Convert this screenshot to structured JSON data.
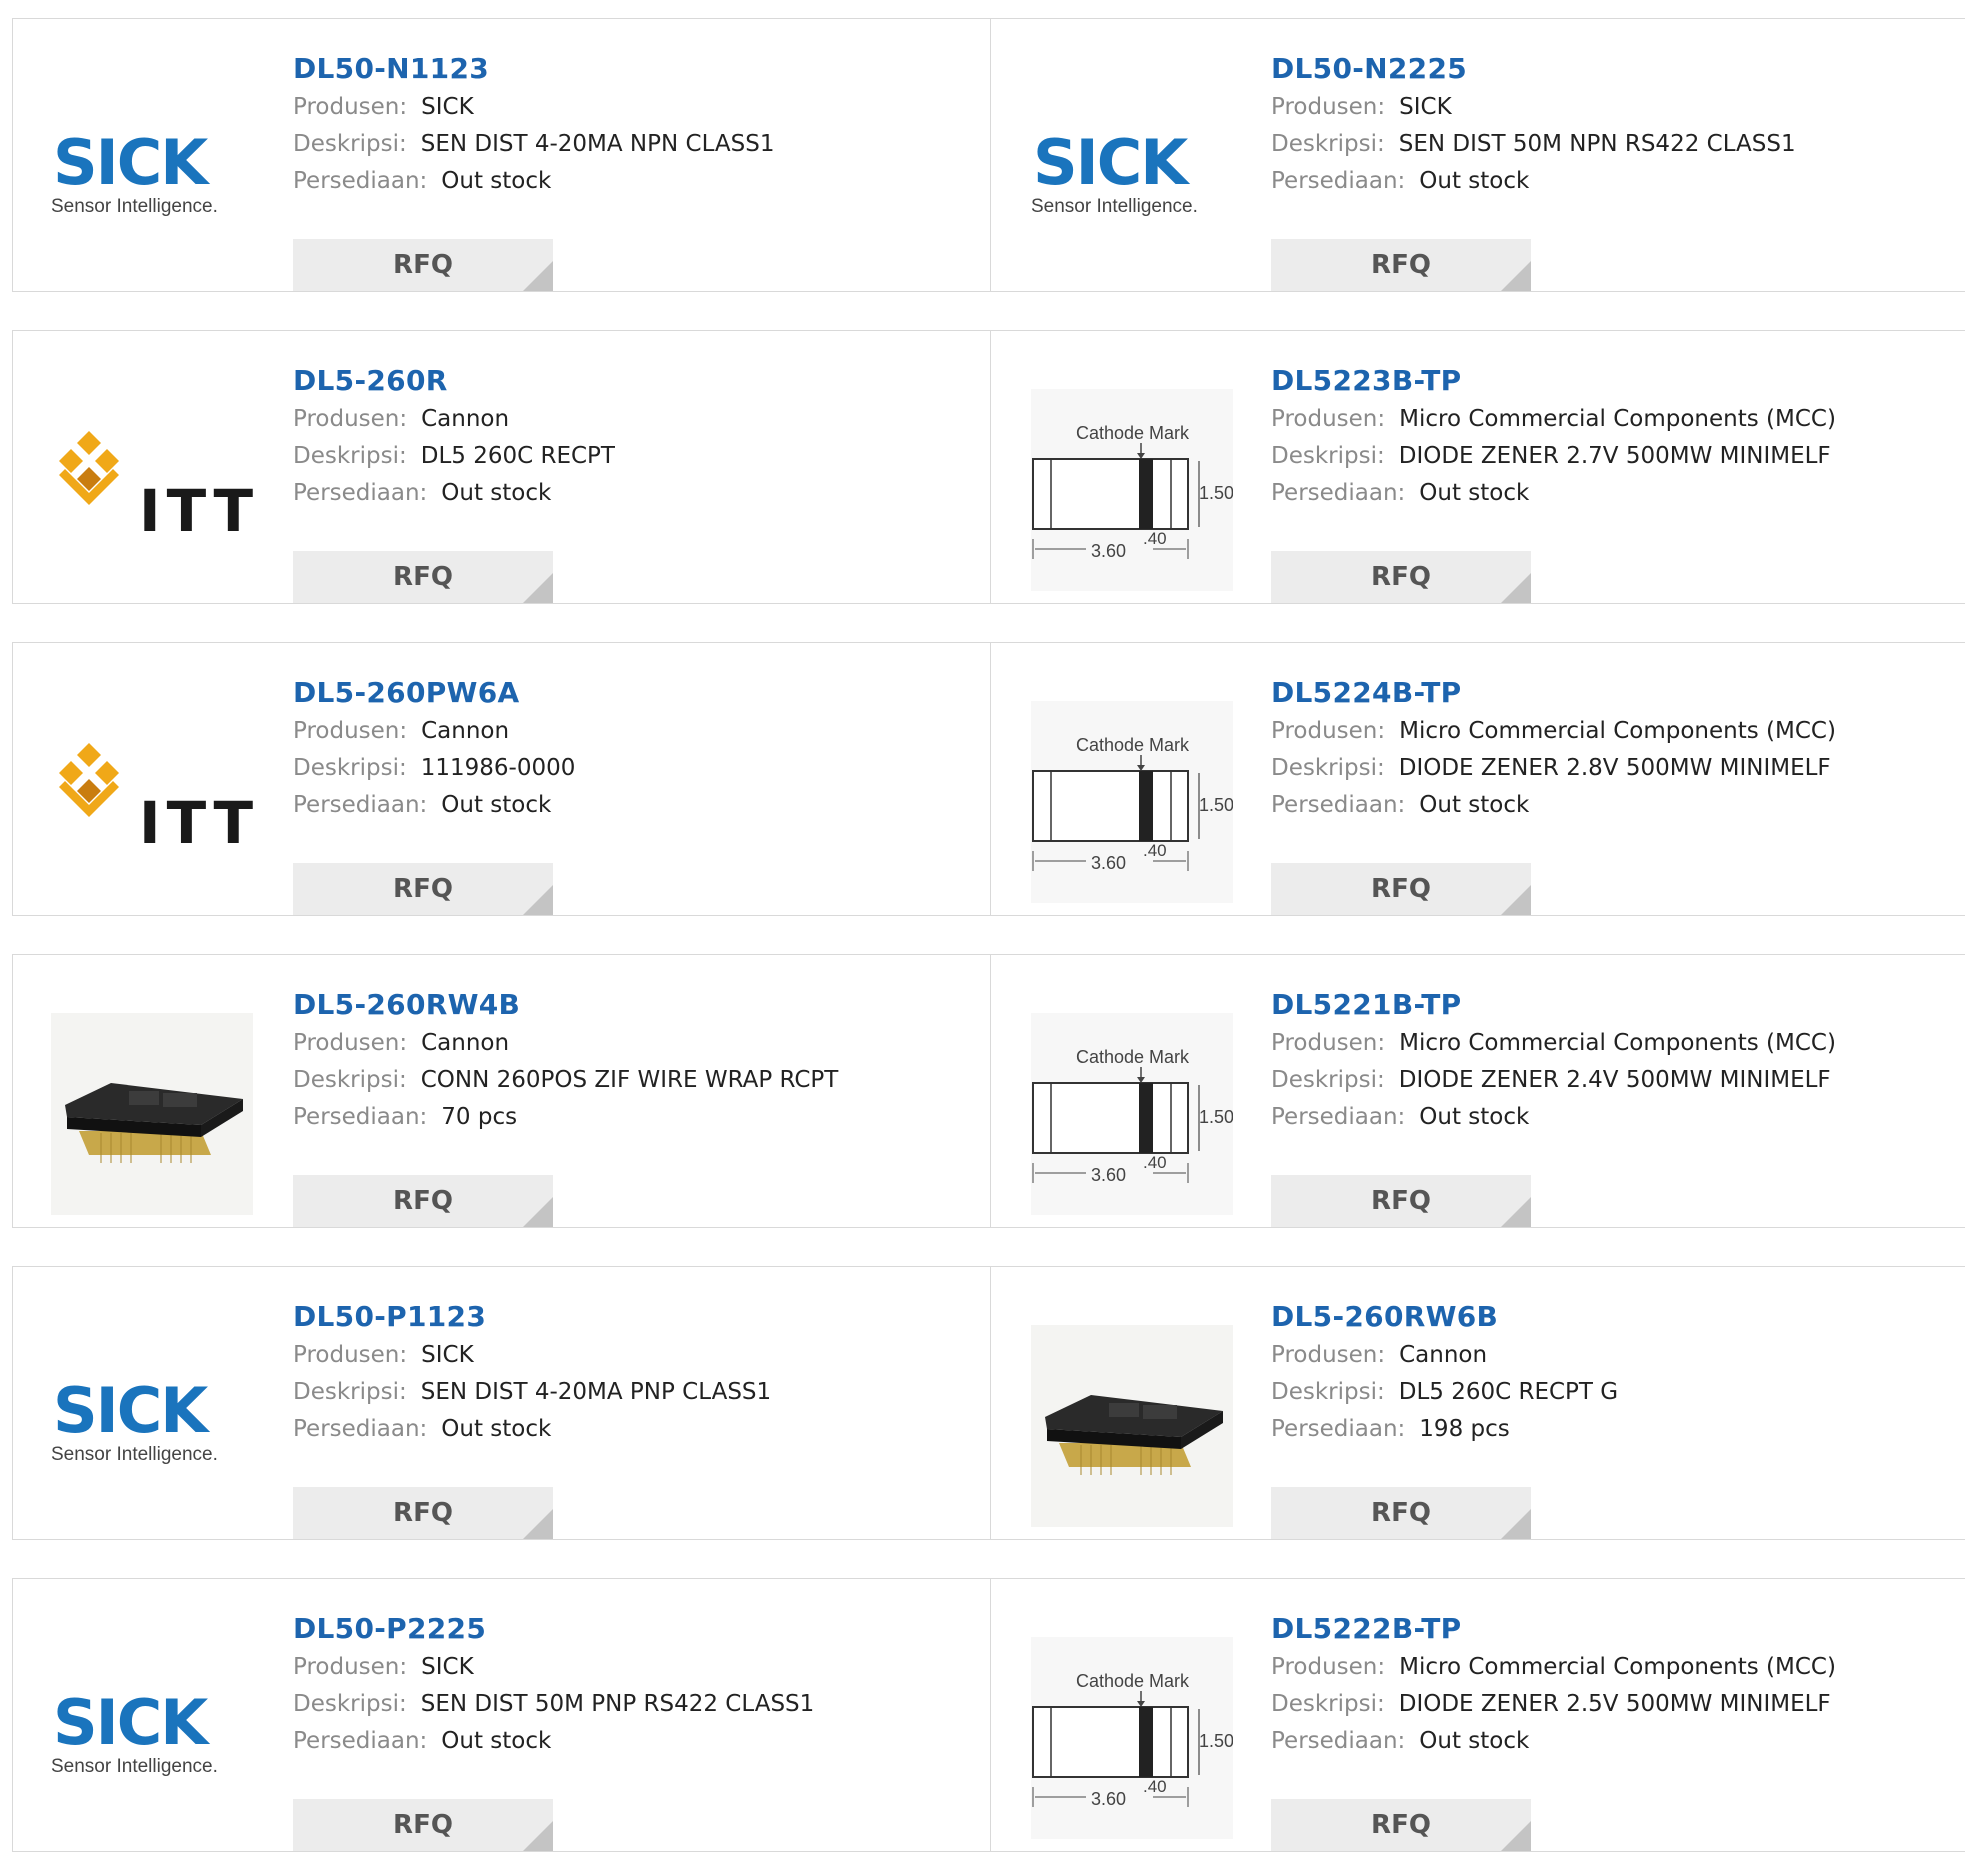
{
  "labels": {
    "manufacturer": "Produsen:",
    "description": "Deskripsi:",
    "stock": "Persediaan:",
    "rfq": "RFQ"
  },
  "logos": {
    "sick_word": "SICK",
    "sick_tagline": "Sensor Intelligence.",
    "itt_word": "ITT"
  },
  "diagram": {
    "caption": "Cathode Mark",
    "height": "1.50",
    "length": "3.60",
    "band": ".40"
  },
  "colors": {
    "title_link": "#1d64ae",
    "sick_blue": "#1a74bd",
    "itt_orange": "#f0a818",
    "rfq_bg": "#ececec"
  },
  "rows": [
    {
      "left": {
        "part": "DL50-N1123",
        "manufacturer": "SICK",
        "description": "SEN DIST 4-20MA NPN CLASS1",
        "stock": "Out stock",
        "image": "sick-logo"
      },
      "right": {
        "part": "DL50-N2225",
        "manufacturer": "SICK",
        "description": "SEN DIST 50M NPN RS422 CLASS1",
        "stock": "Out stock",
        "image": "sick-logo"
      }
    },
    {
      "left": {
        "part": "DL5-260R",
        "manufacturer": "Cannon",
        "description": "DL5 260C RECPT",
        "stock": "Out stock",
        "image": "itt-logo"
      },
      "right": {
        "part": "DL5223B-TP",
        "manufacturer": "Micro Commercial Components (MCC)",
        "description": "DIODE ZENER 2.7V 500MW MINIMELF",
        "stock": "Out stock",
        "image": "diode-diagram"
      }
    },
    {
      "left": {
        "part": "DL5-260PW6A",
        "manufacturer": "Cannon",
        "description": "111986-0000",
        "stock": "Out stock",
        "image": "itt-logo"
      },
      "right": {
        "part": "DL5224B-TP",
        "manufacturer": "Micro Commercial Components (MCC)",
        "description": "DIODE ZENER 2.8V 500MW MINIMELF",
        "stock": "Out stock",
        "image": "diode-diagram"
      }
    },
    {
      "left": {
        "part": "DL5-260RW4B",
        "manufacturer": "Cannon",
        "description": "CONN 260POS ZIF WIRE WRAP RCPT",
        "stock": "70 pcs",
        "image": "connector-photo"
      },
      "right": {
        "part": "DL5221B-TP",
        "manufacturer": "Micro Commercial Components (MCC)",
        "description": "DIODE ZENER 2.4V 500MW MINIMELF",
        "stock": "Out stock",
        "image": "diode-diagram"
      }
    },
    {
      "left": {
        "part": "DL50-P1123",
        "manufacturer": "SICK",
        "description": "SEN DIST 4-20MA PNP CLASS1",
        "stock": "Out stock",
        "image": "sick-logo"
      },
      "right": {
        "part": "DL5-260RW6B",
        "manufacturer": "Cannon",
        "description": "DL5 260C RECPT G",
        "stock": "198 pcs",
        "image": "connector-photo"
      }
    },
    {
      "left": {
        "part": "DL50-P2225",
        "manufacturer": "SICK",
        "description": "SEN DIST 50M PNP RS422 CLASS1",
        "stock": "Out stock",
        "image": "sick-logo"
      },
      "right": {
        "part": "DL5222B-TP",
        "manufacturer": "Micro Commercial Components (MCC)",
        "description": "DIODE ZENER 2.5V 500MW MINIMELF",
        "stock": "Out stock",
        "image": "diode-diagram"
      }
    }
  ]
}
